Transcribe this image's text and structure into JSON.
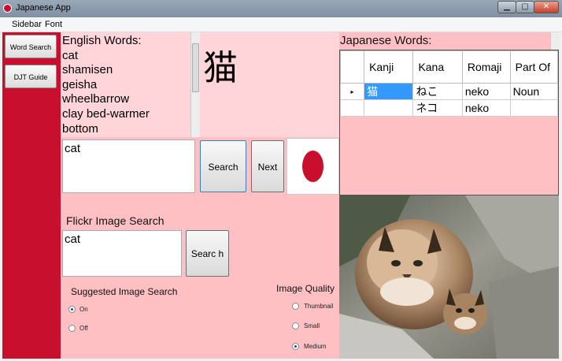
{
  "window": {
    "title": "Japanese App"
  },
  "menu": [
    "Sidebar",
    "Font"
  ],
  "sidebar": {
    "items": [
      {
        "label": "Word Search"
      },
      {
        "label": "DJT Guide"
      }
    ]
  },
  "english": {
    "label": "English Words:",
    "words": [
      "cat",
      "shamisen",
      "geisha",
      "wheelbarrow",
      "clay bed-warmer",
      "bottom"
    ]
  },
  "result_kanji": "猫",
  "search": {
    "value": "cat",
    "search_label": "Search",
    "next_label": "Next"
  },
  "japanese": {
    "label": "Japanese Words:",
    "columns": [
      "Kanji",
      "Kana",
      "Romaji",
      "Part Of"
    ],
    "rows": [
      {
        "kanji": "猫",
        "kana": "ねこ",
        "romaji": "neko",
        "pos": "Noun"
      },
      {
        "kanji": "",
        "kana": "ネコ",
        "romaji": "neko",
        "pos": ""
      }
    ]
  },
  "flickr": {
    "label": "Flickr Image Search",
    "value": "cat",
    "search_label": "Searc h"
  },
  "suggested": {
    "label": "Suggested Image Search",
    "on_label": "On",
    "off_label": "Off",
    "selected": "On"
  },
  "quality": {
    "label": "Image Quality",
    "options": [
      "Thumbnail",
      "Small",
      "Medium"
    ],
    "selected": "Medium"
  },
  "colors": {
    "sidebar": "#c8102e",
    "panel": "#ffc0c4",
    "flag_red": "#c8102e"
  }
}
